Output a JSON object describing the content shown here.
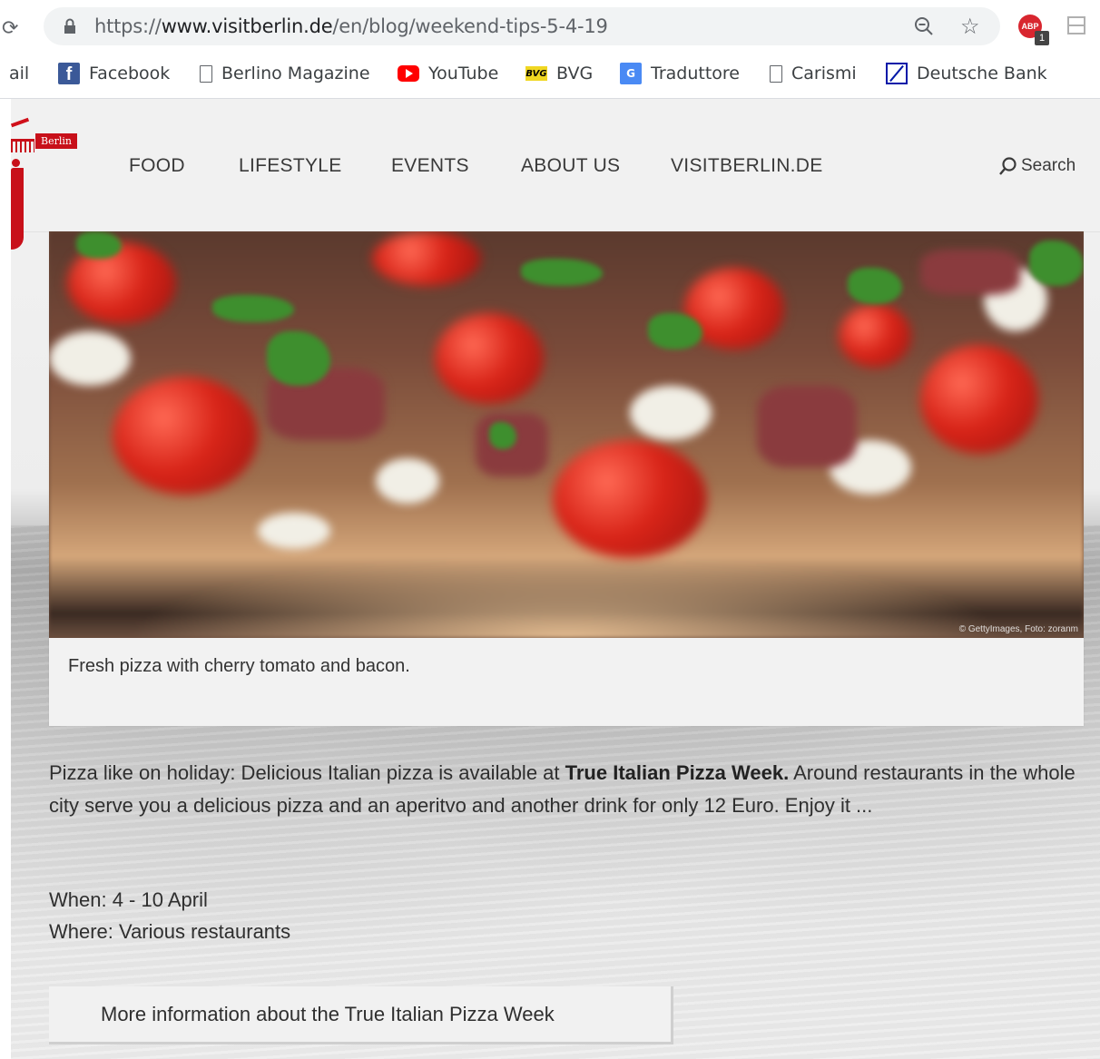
{
  "browser": {
    "url_scheme": "https://",
    "url_host": "www.visitberlin.de",
    "url_path": "/en/blog/weekend-tips-5-4-19",
    "adblock_label": "ABP",
    "adblock_count": "1",
    "bookmarks": [
      {
        "label": "ail",
        "icon": "page-icon"
      },
      {
        "label": "Facebook",
        "icon": "facebook-icon"
      },
      {
        "label": "Berlino Magazine",
        "icon": "page-icon"
      },
      {
        "label": "YouTube",
        "icon": "youtube-icon"
      },
      {
        "label": "BVG",
        "icon": "bvg-icon"
      },
      {
        "label": "Traduttore",
        "icon": "google-translate-icon"
      },
      {
        "label": "Carismi",
        "icon": "page-icon"
      },
      {
        "label": "Deutsche Bank",
        "icon": "deutsche-bank-icon"
      }
    ],
    "bvg_icon_text": "BVG",
    "fb_icon_text": "f",
    "gt_icon_text": "G"
  },
  "site": {
    "logo_badge": "Berlin",
    "nav": [
      "FOOD",
      "LIFESTYLE",
      "EVENTS",
      "ABOUT US",
      "VISITBERLIN.DE"
    ],
    "search_label": "Search"
  },
  "article": {
    "image_credit": "© GettyImages, Foto: zoranm",
    "caption": "Fresh pizza with cherry tomato and bacon.",
    "intro_before": "Pizza like on holiday: Delicious Italian pizza is available at ",
    "intro_bold": "True Italian Pizza Week.",
    "intro_after": " Around restaurants in the whole city serve you a delicious pizza and an aperitvo and another drink for only 12 Euro. Enjoy it ...",
    "when": "When: 4 - 10 April",
    "where": "Where: Various restaurants",
    "more_button": "More information about the True Italian Pizza Week"
  },
  "colors": {
    "brand_red": "#c8101a",
    "nav_text": "#3a3a3a"
  }
}
